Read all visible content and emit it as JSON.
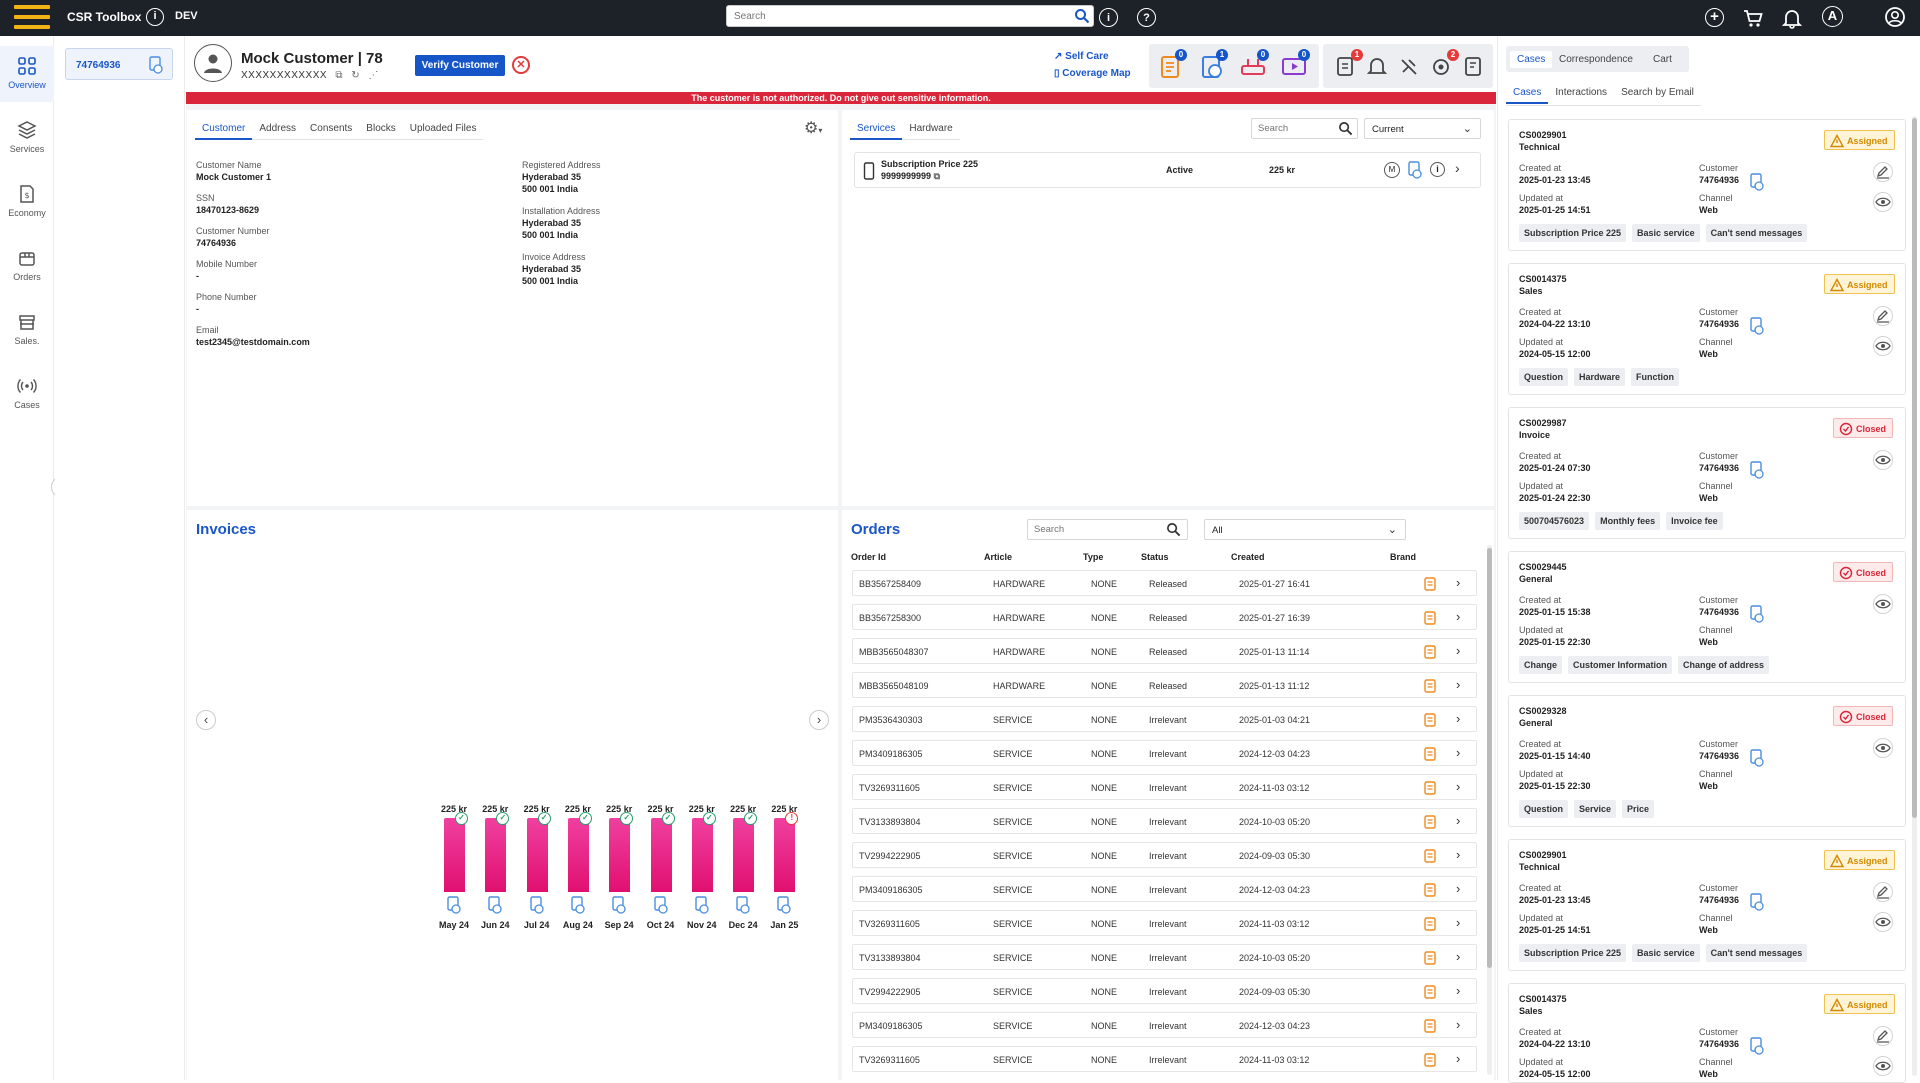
{
  "app": {
    "title": "CSR Toolbox",
    "env": "DEV",
    "search_placeholder": "Search"
  },
  "nav": [
    {
      "label": "Overview",
      "icon": "grid-icon"
    },
    {
      "label": "Services",
      "icon": "layers-icon"
    },
    {
      "label": "Economy",
      "icon": "dollar-doc-icon"
    },
    {
      "label": "Orders",
      "icon": "box-icon"
    },
    {
      "label": "Sales.",
      "icon": "store-icon"
    },
    {
      "label": "Cases",
      "icon": "broadcast-icon"
    }
  ],
  "customer_id_chip": "74764936",
  "customer": {
    "name": "Mock Customer | 78",
    "ssn_masked": "XXXXXXXXXXXX",
    "verify_label": "Verify Customer",
    "self_care": "Self Care",
    "coverage_map": "Coverage Map",
    "badges": [
      "0",
      "1",
      "0",
      "0"
    ],
    "badges2": [
      "1",
      "2"
    ],
    "alert": "The customer is not authorized. Do not give out sensitive information."
  },
  "info_tabs": [
    "Customer",
    "Address",
    "Consents",
    "Blocks",
    "Uploaded Files"
  ],
  "info": {
    "left": [
      {
        "label": "Customer Name",
        "value": "Mock Customer 1"
      },
      {
        "label": "SSN",
        "value": "18470123-8629"
      },
      {
        "label": "Customer Number",
        "value": "74764936"
      },
      {
        "label": "Mobile Number",
        "value": "-"
      },
      {
        "label": "Phone Number",
        "value": "-"
      },
      {
        "label": "Email",
        "value": "test2345@testdomain.com"
      }
    ],
    "right": [
      {
        "label": "Registered Address",
        "value": "Hyderabad 35",
        "value2": "500 001 India"
      },
      {
        "label": "Installation Address",
        "value": "Hyderabad 35",
        "value2": "500 001 India"
      },
      {
        "label": "Invoice Address",
        "value": "Hyderabad 35",
        "value2": "500 001 India"
      }
    ]
  },
  "services": {
    "tabs": [
      "Services",
      "Hardware"
    ],
    "search_placeholder": "Search",
    "filter": "Current",
    "row": {
      "name": "Subscription Price 225",
      "number": "9999999999",
      "status": "Active",
      "price": "225 kr"
    }
  },
  "invoices": {
    "title": "Invoices",
    "items": [
      {
        "month": "May 24",
        "amount": "225 kr",
        "paid": true
      },
      {
        "month": "Jun 24",
        "amount": "225 kr",
        "paid": true
      },
      {
        "month": "Jul 24",
        "amount": "225 kr",
        "paid": true
      },
      {
        "month": "Aug 24",
        "amount": "225 kr",
        "paid": true
      },
      {
        "month": "Sep 24",
        "amount": "225 kr",
        "paid": true
      },
      {
        "month": "Oct 24",
        "amount": "225 kr",
        "paid": true
      },
      {
        "month": "Nov 24",
        "amount": "225 kr",
        "paid": true
      },
      {
        "month": "Dec 24",
        "amount": "225 kr",
        "paid": true
      },
      {
        "month": "Jan 25",
        "amount": "225 kr",
        "paid": false
      }
    ]
  },
  "orders": {
    "title": "Orders",
    "search_placeholder": "Search",
    "filter": "All",
    "headers": [
      "Order Id",
      "Article",
      "Type",
      "Status",
      "Created",
      "Brand"
    ],
    "rows": [
      [
        "BB3567258409",
        "HARDWARE",
        "NONE",
        "Released",
        "2025-01-27 16:41"
      ],
      [
        "BB3567258300",
        "HARDWARE",
        "NONE",
        "Released",
        "2025-01-27 16:39"
      ],
      [
        "MBB3565048307",
        "HARDWARE",
        "NONE",
        "Released",
        "2025-01-13 11:14"
      ],
      [
        "MBB3565048109",
        "HARDWARE",
        "NONE",
        "Released",
        "2025-01-13 11:12"
      ],
      [
        "PM3536430303",
        "SERVICE",
        "NONE",
        "Irrelevant",
        "2025-01-03 04:21"
      ],
      [
        "PM3409186305",
        "SERVICE",
        "NONE",
        "Irrelevant",
        "2024-12-03 04:23"
      ],
      [
        "TV3269311605",
        "SERVICE",
        "NONE",
        "Irrelevant",
        "2024-11-03 03:12"
      ],
      [
        "TV3133893804",
        "SERVICE",
        "NONE",
        "Irrelevant",
        "2024-10-03 05:20"
      ],
      [
        "TV2994222905",
        "SERVICE",
        "NONE",
        "Irrelevant",
        "2024-09-03 05:30"
      ],
      [
        "PM3409186305",
        "SERVICE",
        "NONE",
        "Irrelevant",
        "2024-12-03 04:23"
      ],
      [
        "TV3269311605",
        "SERVICE",
        "NONE",
        "Irrelevant",
        "2024-11-03 03:12"
      ],
      [
        "TV3133893804",
        "SERVICE",
        "NONE",
        "Irrelevant",
        "2024-10-03 05:20"
      ],
      [
        "TV2994222905",
        "SERVICE",
        "NONE",
        "Irrelevant",
        "2024-09-03 05:30"
      ],
      [
        "PM3409186305",
        "SERVICE",
        "NONE",
        "Irrelevant",
        "2024-12-03 04:23"
      ],
      [
        "TV3269311605",
        "SERVICE",
        "NONE",
        "Irrelevant",
        "2024-11-03 03:12"
      ]
    ]
  },
  "right_tabs": [
    "Cases",
    "Correspondence",
    "Cart"
  ],
  "right_subtabs": [
    "Cases",
    "Interactions",
    "Search by Email"
  ],
  "case_labels": {
    "created": "Created at",
    "updated": "Updated at",
    "customer": "Customer",
    "channel": "Channel"
  },
  "cases": [
    {
      "id": "CS0029901",
      "type": "Technical",
      "status": "Assigned",
      "created": "2025-01-23 13:45",
      "updated": "2025-01-25 14:51",
      "customer": "74764936",
      "channel": "Web",
      "tags": [
        "Subscription Price 225",
        "Basic service",
        "Can't send messages"
      ],
      "editable": true
    },
    {
      "id": "CS0014375",
      "type": "Sales",
      "status": "Assigned",
      "created": "2024-04-22 13:10",
      "updated": "2024-05-15 12:00",
      "customer": "74764936",
      "channel": "Web",
      "tags": [
        "Question",
        "Hardware",
        "Function"
      ],
      "editable": true
    },
    {
      "id": "CS0029987",
      "type": "Invoice",
      "status": "Closed",
      "created": "2025-01-24 07:30",
      "updated": "2025-01-24 22:30",
      "customer": "74764936",
      "channel": "Web",
      "tags": [
        "500704576023",
        "Monthly fees",
        "Invoice fee"
      ],
      "editable": false
    },
    {
      "id": "CS0029445",
      "type": "General",
      "status": "Closed",
      "created": "2025-01-15 15:38",
      "updated": "2025-01-15 22:30",
      "customer": "74764936",
      "channel": "Web",
      "tags": [
        "Change",
        "Customer Information",
        "Change of address"
      ],
      "editable": false
    },
    {
      "id": "CS0029328",
      "type": "General",
      "status": "Closed",
      "created": "2025-01-15 14:40",
      "updated": "2025-01-15 22:30",
      "customer": "74764936",
      "channel": "Web",
      "tags": [
        "Question",
        "Service",
        "Price"
      ],
      "editable": false
    },
    {
      "id": "CS0029901",
      "type": "Technical",
      "status": "Assigned",
      "created": "2025-01-23 13:45",
      "updated": "2025-01-25 14:51",
      "customer": "74764936",
      "channel": "Web",
      "tags": [
        "Subscription Price 225",
        "Basic service",
        "Can't send messages"
      ],
      "editable": true
    },
    {
      "id": "CS0014375",
      "type": "Sales",
      "status": "Assigned",
      "created": "2024-04-22 13:10",
      "updated": "2024-05-15 12:00",
      "customer": "74764936",
      "channel": "Web",
      "tags": [],
      "editable": true
    }
  ],
  "colors": {
    "accent": "#1a56c8",
    "alert": "#d9263a",
    "bar": "#e8158a",
    "assigned": "#d28a00",
    "closed": "#d9263a",
    "topbar": "#1d2229"
  }
}
